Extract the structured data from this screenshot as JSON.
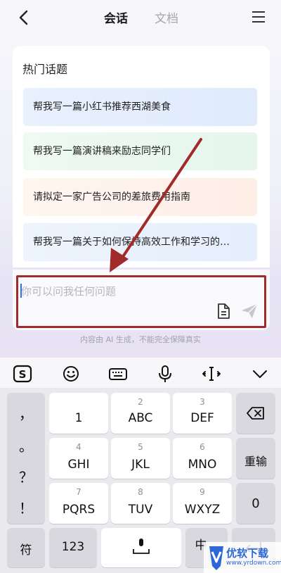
{
  "header": {
    "tab_chat": "会话",
    "tab_docs": "文档",
    "back_icon": "chevron-left-icon",
    "menu_icon": "hamburger-menu-icon"
  },
  "topics": {
    "title": "热门话题",
    "items": [
      "帮我写一篇小红书推荐西湖美食",
      "帮我写一篇演讲稿来励志同学们",
      "请拟定一家广告公司的差旅费用指南",
      "帮我写一篇关于如何保持高效工作和学习的…"
    ]
  },
  "composer": {
    "placeholder": "你可以问我任何问题",
    "disclaimer": "内容由 AI 生成，不能完全保障真实"
  },
  "keyboard": {
    "side_symbols": [
      "，",
      "。",
      "？",
      "！"
    ],
    "keys": [
      {
        "sub": "",
        "main": "1"
      },
      {
        "sub": "2",
        "main": "ABC"
      },
      {
        "sub": "3",
        "main": "DEF"
      },
      {
        "sub": "4",
        "main": "GHI"
      },
      {
        "sub": "5",
        "main": "JKL"
      },
      {
        "sub": "6",
        "main": "MNO"
      },
      {
        "sub": "7",
        "main": "PQRS"
      },
      {
        "sub": "8",
        "main": "TUV"
      },
      {
        "sub": "9",
        "main": "WXYZ"
      }
    ],
    "delete_icon": "backspace-icon",
    "reenter": "重输",
    "zero": "0",
    "symbols": "符",
    "num123": "123",
    "lang": "中",
    "lang_sub": "英",
    "enter_icon": "return-icon"
  },
  "watermark": {
    "name": "优软下载",
    "url": "www.yrdown.com"
  },
  "colors": {
    "highlight": "#a12b2b",
    "accent": "#2c66d8"
  }
}
